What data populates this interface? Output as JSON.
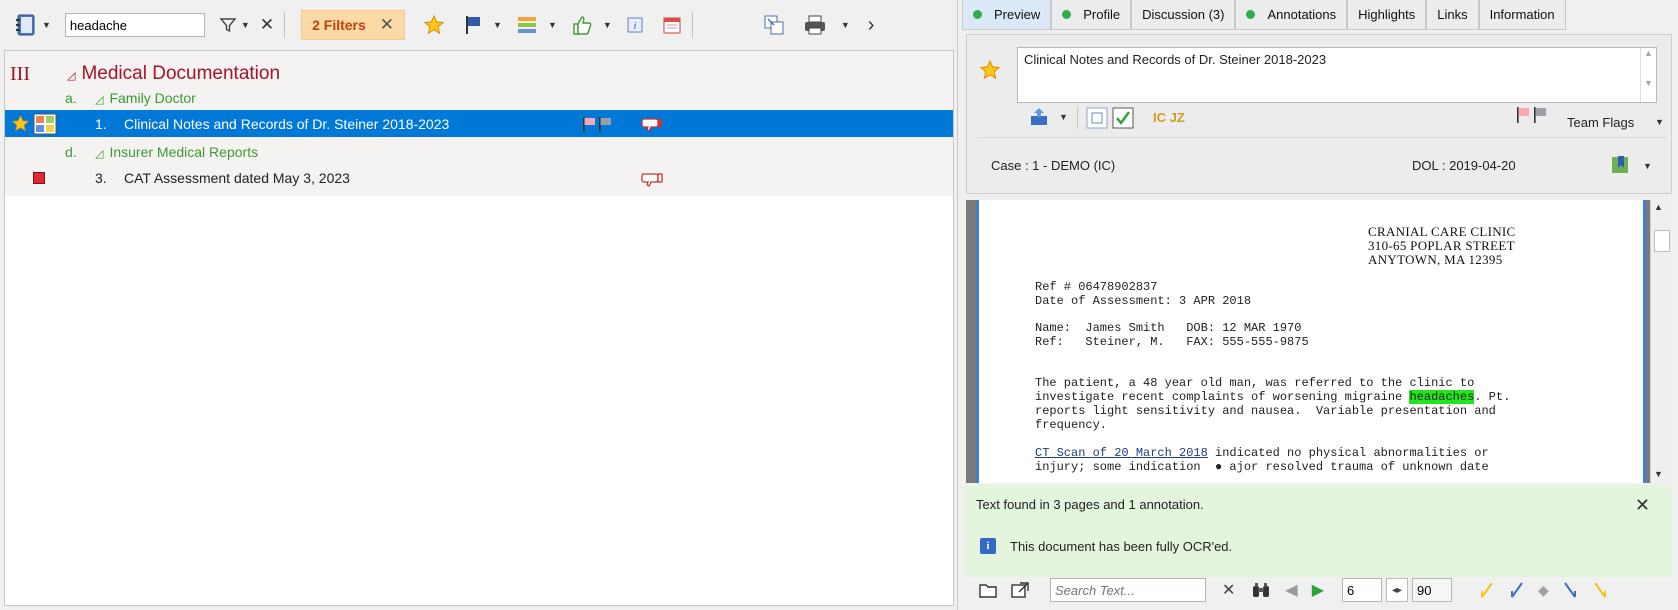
{
  "left_toolbar": {
    "search_value": "headache",
    "filters_label": "2 Filters",
    "filters_clear": "✕"
  },
  "tree": {
    "section": {
      "number": "III",
      "title": "Medical Documentation"
    },
    "groups": [
      {
        "letter": "a.",
        "title": "Family Doctor",
        "docs": [
          {
            "number": "1.",
            "title": "Clinical Notes and Records of Dr. Steiner 2018-2023",
            "selected": true
          }
        ]
      },
      {
        "letter": "d.",
        "title": "Insurer Medical Reports",
        "docs": [
          {
            "number": "3.",
            "title": "CAT Assessment dated May 3, 2023",
            "selected": false
          }
        ]
      }
    ]
  },
  "tabs": [
    {
      "label": "Preview",
      "dot": true,
      "active": true
    },
    {
      "label": "Profile",
      "dot": true,
      "active": false
    },
    {
      "label": "Discussion (3)",
      "dot": false,
      "active": false
    },
    {
      "label": "Annotations",
      "dot": true,
      "active": false
    },
    {
      "label": "Highlights",
      "dot": false,
      "active": false
    },
    {
      "label": "Links",
      "dot": false,
      "active": false
    },
    {
      "label": "Information",
      "dot": false,
      "active": false
    }
  ],
  "preview": {
    "doc_title": "Clinical Notes and Records of Dr. Steiner 2018-2023",
    "initials": "IC JZ",
    "team_flags_label": "Team Flags",
    "case_label": "Case : 1 - DEMO (IC)",
    "dol_label": "DOL : 2019-04-20"
  },
  "document": {
    "clinic_name": "CRANIAL CARE CLINIC",
    "clinic_street": "310-65 POPLAR STREET",
    "clinic_city": "ANYTOWN, MA 12395",
    "ref_line": "Ref # 06478902837",
    "date_line": "Date of Assessment: 3 APR 2018",
    "name_line": "Name:  James Smith   DOB: 12 MAR 1970",
    "ref2_line": "Ref:   Steiner, M.   FAX: 555-555-9875",
    "para1_line1": "The patient, a 48 year old man, was referred to the clinic to",
    "para1_line2_pre": "investigate recent complaints of worsening migraine ",
    "para1_highlight": "headaches",
    "para1_line2_post": ". Pt.",
    "para1_line3": "reports light sensitivity and nausea.  Variable presentation and",
    "para1_line4": "frequency.",
    "para2_link": "CT Scan of 20 March 2018",
    "para2_line1_post": " indicated no physical abnormalities or",
    "para2_line2": "injury; some indication  ● ajor resolved trauma of unknown date"
  },
  "find": {
    "result_text": "Text found in 3 pages and 1 annotation.",
    "ocr_text": "This document has been fully OCR'ed."
  },
  "bottom": {
    "search_placeholder": "Search Text...",
    "page_value": "6",
    "total_pages": "90"
  },
  "colors": {
    "selection": "#0078d7",
    "section_red": "#a3142a",
    "group_green": "#3c9a34",
    "highlight": "#22e61c",
    "find_bg": "#e3f5dc"
  }
}
